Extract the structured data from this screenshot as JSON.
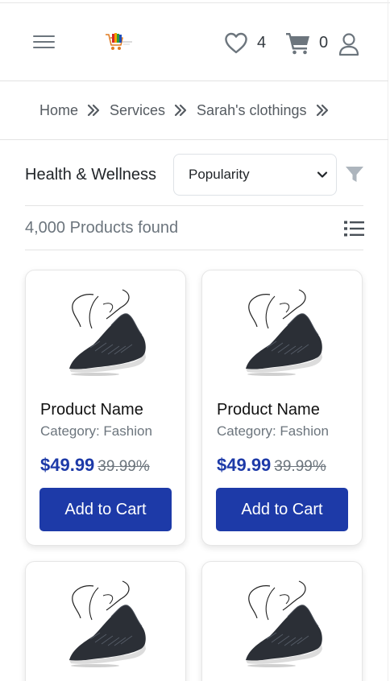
{
  "header": {
    "menu_icon": "hamburger-icon",
    "logo_icon": "store-cart-logo",
    "wishlist_icon": "heart-icon",
    "wishlist_count": "4",
    "cart_icon": "shopping-cart-icon",
    "cart_count": "0",
    "user_icon": "user-icon"
  },
  "breadcrumb": {
    "items": [
      "Home",
      "Services",
      "Sarah's clothings"
    ],
    "separator_icon": "double-chevron-right-icon"
  },
  "toolbar": {
    "category_title": "Health & Wellness",
    "sort_value": "Popularity",
    "sort_icon": "chevron-down-icon",
    "filter_icon": "filter-icon",
    "products_found": "4,000 Products found",
    "list_view_icon": "list-view-icon"
  },
  "products": [
    {
      "name": "Product Name",
      "category": "Category: Fashion",
      "price": "$49.99",
      "old_price": "39.99%",
      "button": "Add to Cart",
      "image_icon": "sneaker-image"
    },
    {
      "name": "Product Name",
      "category": "Category: Fashion",
      "price": "$49.99",
      "old_price": "39.99%",
      "button": "Add to Cart",
      "image_icon": "sneaker-image"
    }
  ],
  "colors": {
    "accent": "#1d3aa8",
    "icon_gray": "#6c757d",
    "muted_text": "#6c757d"
  }
}
